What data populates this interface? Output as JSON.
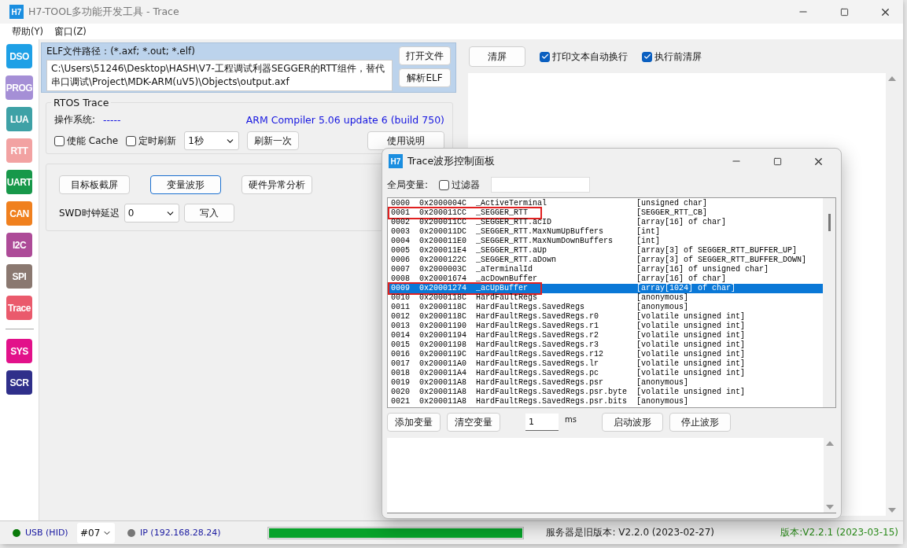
{
  "window": {
    "logo": "H7",
    "title": "H7-TOOL多功能开发工具 - Trace"
  },
  "menu": [
    "帮助(Y)",
    "窗口(Z)"
  ],
  "sidebar": {
    "tools": [
      {
        "label": "DSO",
        "color": "#1ea0e6"
      },
      {
        "label": "PROG",
        "color": "#a58fd6"
      },
      {
        "label": "LUA",
        "color": "#3ea1a6"
      },
      {
        "label": "RTT",
        "color": "#f2a2a2"
      },
      {
        "label": "UART",
        "color": "#17984a"
      },
      {
        "label": "CAN",
        "color": "#f0801e"
      },
      {
        "label": "I2C",
        "color": "#ad4b98"
      },
      {
        "label": "SPI",
        "color": "#8a7870"
      },
      {
        "label": "Trace",
        "color": "#ea5a6c"
      }
    ],
    "system": [
      {
        "label": "SYS",
        "color": "#e2118a"
      },
      {
        "label": "SCR",
        "color": "#2f2f8a"
      }
    ]
  },
  "elf": {
    "label": "ELF文件路径：(*.axf; *.out; *.elf)",
    "path": "C:\\Users\\51246\\Desktop\\HASH\\V7-工程调试利器SEGGER的RTT组件，替代串口调试\\Project\\MDK-ARM(uV5)\\Objects\\output.axf",
    "buttons": [
      "打开文件",
      "解析ELF"
    ]
  },
  "rtos": {
    "title": "RTOS Trace",
    "os_label": "操作系统:",
    "os_value": "-----",
    "compiler": "ARM Compiler 5.06 update 6 (build 750)",
    "enable_cache": {
      "label": "使能 Cache",
      "checked": false
    },
    "timed_refresh": {
      "label": "定时刷新",
      "checked": false
    },
    "interval": "1秒",
    "refresh_button": "刷新一次",
    "help_button": "使用说明"
  },
  "tools": {
    "buttons": [
      {
        "label": "目标板截屏",
        "focused": false
      },
      {
        "label": "变量波形",
        "focused": true
      },
      {
        "label": "硬件异常分析",
        "focused": false
      }
    ],
    "swd_label": "SWD时钟延迟",
    "swd_value": "0",
    "write_button": "写入"
  },
  "console": {
    "clear_button": "清屏",
    "options": [
      {
        "label": "打印文本自动换行",
        "checked": true
      },
      {
        "label": "执行前清屏",
        "checked": true
      }
    ]
  },
  "status_bar": {
    "usb": {
      "label": "USB (HID)",
      "connected": true
    },
    "device": "#07",
    "ip": {
      "label": "IP (192.168.28.24)",
      "connected": false
    },
    "progress": {
      "level": 1
    },
    "server_version": "服务器是旧版本: V2.2.0 (2023-02-27)",
    "version": "版本:V2.2.1 (2023-03-15)"
  },
  "dialog": {
    "logo": "H7",
    "title": "Trace波形控制面板",
    "globals_label": "全局变量:",
    "filter": {
      "label": "过滤器",
      "checked": false
    },
    "variables": [
      {
        "index": "0000",
        "address": "0x2000004C",
        "name": "_ActiveTerminal",
        "type": "[unsigned char]",
        "selected": false,
        "highlighted": false
      },
      {
        "index": "0001",
        "address": "0x200011CC",
        "name": "_SEGGER_RTT",
        "type": "[SEGGER_RTT_CB]",
        "selected": false,
        "highlighted": true
      },
      {
        "index": "0002",
        "address": "0x200011CC",
        "name": "_SEGGER_RTT.acID",
        "type": "[array[16] of char]",
        "selected": false,
        "highlighted": false
      },
      {
        "index": "0003",
        "address": "0x200011DC",
        "name": "_SEGGER_RTT.MaxNumUpBuffers",
        "type": "[int]",
        "selected": false,
        "highlighted": false
      },
      {
        "index": "0004",
        "address": "0x200011E0",
        "name": "_SEGGER_RTT.MaxNumDownBuffers",
        "type": "[int]",
        "selected": false,
        "highlighted": false
      },
      {
        "index": "0005",
        "address": "0x200011E4",
        "name": "_SEGGER_RTT.aUp",
        "type": "[array[3] of SEGGER_RTT_BUFFER_UP]",
        "selected": false,
        "highlighted": false
      },
      {
        "index": "0006",
        "address": "0x2000122C",
        "name": "_SEGGER_RTT.aDown",
        "type": "[array[3] of SEGGER_RTT_BUFFER_DOWN]",
        "selected": false,
        "highlighted": false
      },
      {
        "index": "0007",
        "address": "0x2000003C",
        "name": "_aTerminalId",
        "type": "[array[16] of unsigned char]",
        "selected": false,
        "highlighted": false
      },
      {
        "index": "0008",
        "address": "0x20001674",
        "name": "_acDownBuffer",
        "type": "[array[16] of char]",
        "selected": false,
        "highlighted": false
      },
      {
        "index": "0009",
        "address": "0x20001274",
        "name": "_acUpBuffer",
        "type": "[array[1024] of char]",
        "selected": true,
        "highlighted": true
      },
      {
        "index": "0010",
        "address": "0x2000118C",
        "name": "HardFaultRegs",
        "type": "[anonymous]",
        "selected": false,
        "highlighted": false
      },
      {
        "index": "0011",
        "address": "0x2000118C",
        "name": "HardFaultRegs.SavedRegs",
        "type": "[anonymous]",
        "selected": false,
        "highlighted": false
      },
      {
        "index": "0012",
        "address": "0x2000118C",
        "name": "HardFaultRegs.SavedRegs.r0",
        "type": "[volatile unsigned int]",
        "selected": false,
        "highlighted": false
      },
      {
        "index": "0013",
        "address": "0x20001190",
        "name": "HardFaultRegs.SavedRegs.r1",
        "type": "[volatile unsigned int]",
        "selected": false,
        "highlighted": false
      },
      {
        "index": "0014",
        "address": "0x20001194",
        "name": "HardFaultRegs.SavedRegs.r2",
        "type": "[volatile unsigned int]",
        "selected": false,
        "highlighted": false
      },
      {
        "index": "0015",
        "address": "0x20001198",
        "name": "HardFaultRegs.SavedRegs.r3",
        "type": "[volatile unsigned int]",
        "selected": false,
        "highlighted": false
      },
      {
        "index": "0016",
        "address": "0x2000119C",
        "name": "HardFaultRegs.SavedRegs.r12",
        "type": "[volatile unsigned int]",
        "selected": false,
        "highlighted": false
      },
      {
        "index": "0017",
        "address": "0x200011A0",
        "name": "HardFaultRegs.SavedRegs.lr",
        "type": "[volatile unsigned int]",
        "selected": false,
        "highlighted": false
      },
      {
        "index": "0018",
        "address": "0x200011A4",
        "name": "HardFaultRegs.SavedRegs.pc",
        "type": "[volatile unsigned int]",
        "selected": false,
        "highlighted": false
      },
      {
        "index": "0019",
        "address": "0x200011A8",
        "name": "HardFaultRegs.SavedRegs.psr",
        "type": "[anonymous]",
        "selected": false,
        "highlighted": false
      },
      {
        "index": "0020",
        "address": "0x200011A8",
        "name": "HardFaultRegs.SavedRegs.psr.byte",
        "type": "[volatile unsigned int]",
        "selected": false,
        "highlighted": false
      },
      {
        "index": "0021",
        "address": "0x200011A8",
        "name": "HardFaultRegs.SavedRegs.psr.bits",
        "type": "[anonymous]",
        "selected": false,
        "highlighted": false
      }
    ],
    "add_button": "添加变量",
    "clear_button": "清空变量",
    "period": "1",
    "unit": "ms",
    "start_button": "启动波形",
    "stop_button": "停止波形"
  }
}
